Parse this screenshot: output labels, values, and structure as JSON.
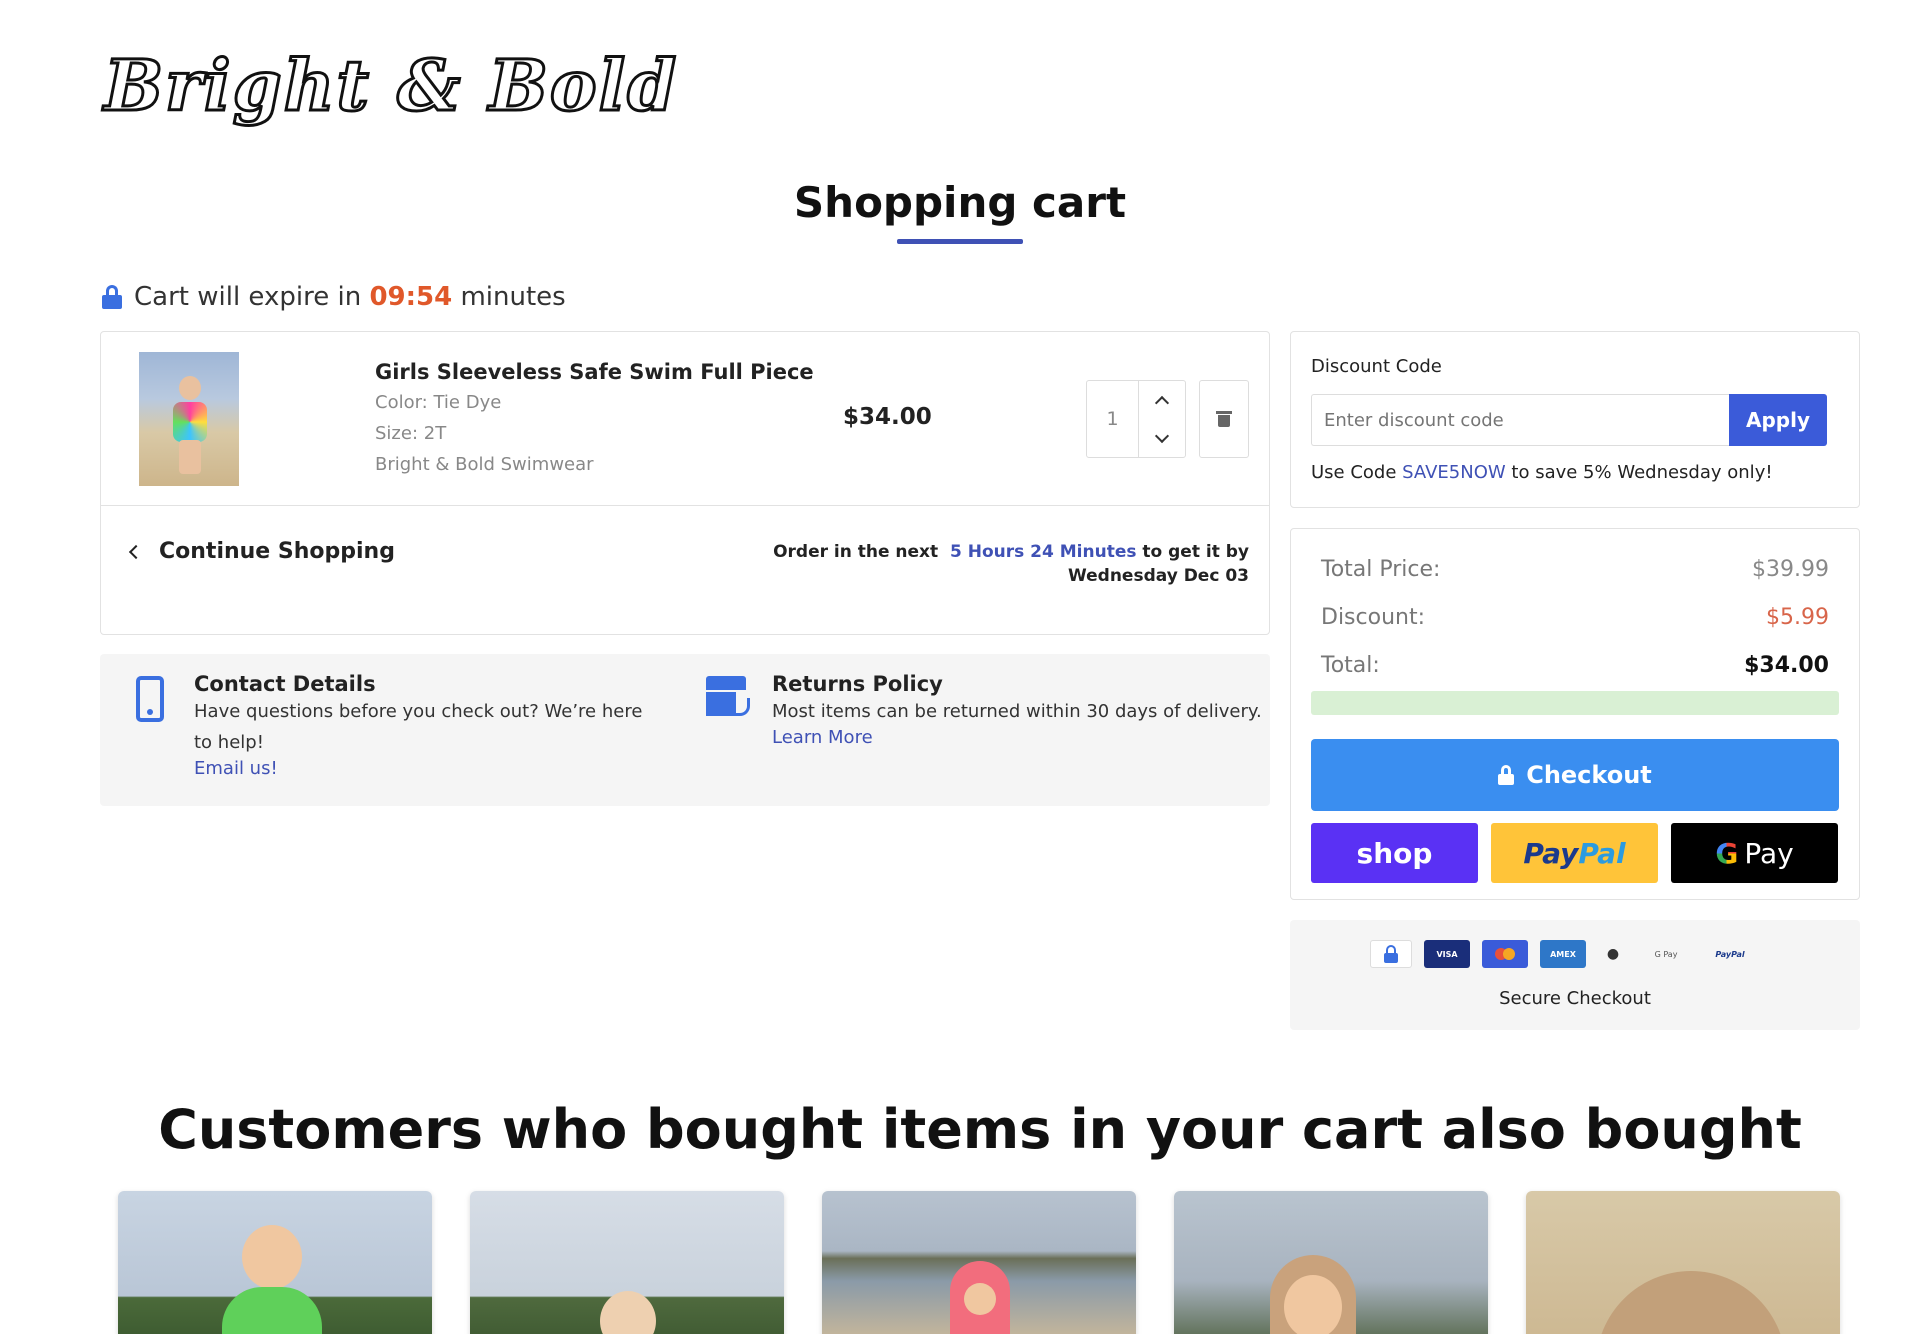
{
  "brand": {
    "logo_text": "Bright & Bold"
  },
  "page": {
    "title": "Shopping cart"
  },
  "timer": {
    "prefix": "Cart will expire in",
    "time": "09:54",
    "suffix": "minutes"
  },
  "cart": {
    "items": [
      {
        "name": "Girls Sleeveless Safe Swim Full Piece",
        "color": "Color: Tie Dye",
        "size": "Size: 2T",
        "vendor": "Bright & Bold Swimwear",
        "price": "$34.00",
        "quantity": "1"
      }
    ],
    "continue_label": "Continue Shopping",
    "delivery": {
      "prefix": "Order in the next",
      "highlight": "5 Hours 24 Minutes",
      "suffix": "to get it by Wednesday Dec 03"
    }
  },
  "info": {
    "contact": {
      "title": "Contact Details",
      "text": "Have questions before you check out? We’re here to help!",
      "link": "Email us!"
    },
    "returns": {
      "title": "Returns Policy",
      "text": "Most items can be returned within 30 days of delivery.",
      "link": "Learn More"
    }
  },
  "discount": {
    "label": "Discount Code",
    "placeholder": "Enter discount code",
    "apply_label": "Apply",
    "promo_prefix": "Use Code",
    "promo_code": "SAVE5NOW",
    "promo_suffix": "to save 5% Wednesday only!"
  },
  "totals": {
    "total_price_label": "Total Price:",
    "total_price": "$39.99",
    "discount_label": "Discount:",
    "discount": "$5.99",
    "total_label": "Total:",
    "total": "$34.00",
    "checkout_label": "Checkout",
    "shop_label": "shop",
    "paypal_label_1": "Pay",
    "paypal_label_2": "Pal",
    "gpay_g": "G",
    "gpay_label": "Pay"
  },
  "secure": {
    "label": "Secure Checkout",
    "icons": [
      "lock-icon",
      "visa-icon",
      "mastercard-icon",
      "amex-icon",
      "apple-pay-icon",
      "google-pay-icon",
      "paypal-icon"
    ],
    "visa_text": "VISA",
    "amex_text": "AMEX",
    "gpay_text": "G Pay",
    "paypal_text": "PayPal"
  },
  "recommendations": {
    "title": "Customers who bought items in your cart also bought"
  },
  "colors": {
    "accent": "#3f51b5",
    "timer": "#e0582a",
    "checkout": "#3a8ef0",
    "shop": "#5a31f4",
    "paypal": "#ffc439"
  }
}
